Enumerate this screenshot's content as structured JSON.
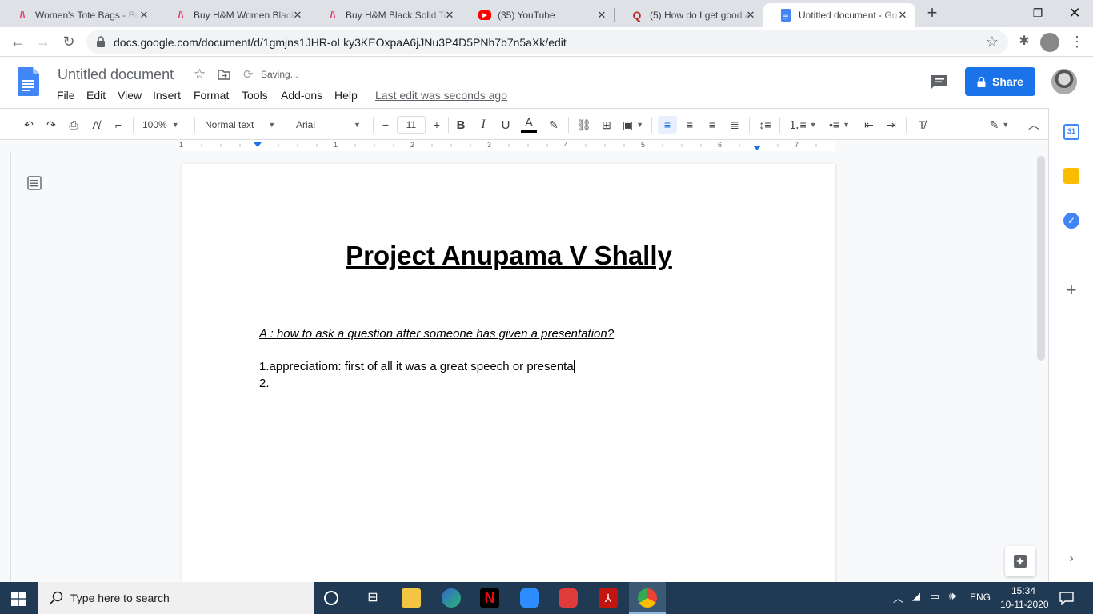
{
  "tabs": [
    {
      "title": "Women's Tote Bags - Bu",
      "icon": "myntra-icon"
    },
    {
      "title": "Buy H&M Women Black",
      "icon": "myntra-icon"
    },
    {
      "title": "Buy H&M Black Solid To",
      "icon": "myntra-icon"
    },
    {
      "title": "(35) YouTube",
      "icon": "youtube-icon"
    },
    {
      "title": "(5) How do I get good a",
      "icon": "quora-icon"
    },
    {
      "title": "Untitled document - Go",
      "icon": "docs-icon",
      "active": true
    }
  ],
  "browser": {
    "url": "docs.google.com/document/d/1gmjns1JHR-oLky3KEOxpaA6jJNu3P4D5PNh7b7n5aXk/edit"
  },
  "docs": {
    "title": "Untitled document",
    "saving": "Saving...",
    "menu": [
      "File",
      "Edit",
      "View",
      "Insert",
      "Format",
      "Tools",
      "Add-ons",
      "Help"
    ],
    "last_edit": "Last edit was seconds ago",
    "share_label": "Share"
  },
  "toolbar": {
    "zoom": "100%",
    "style": "Normal text",
    "font": "Arial",
    "font_size": "11"
  },
  "ruler_numbers": [
    "1",
    "1",
    "2",
    "3",
    "4",
    "5",
    "6",
    "7"
  ],
  "document": {
    "heading": "Project  Anupama V Shally",
    "question": "A : how to ask a question after someone has given a presentation?",
    "line1": "1.appreciatiom: first of all it was a great speech or presenta",
    "line2": "2."
  },
  "taskbar": {
    "search_placeholder": "Type here to search",
    "language": "ENG",
    "time": "15:34",
    "date": "10-11-2020"
  },
  "colors": {
    "accent": "#1a73e8",
    "taskbar": "#1f3a52",
    "docs_blue": "#4285f4"
  }
}
